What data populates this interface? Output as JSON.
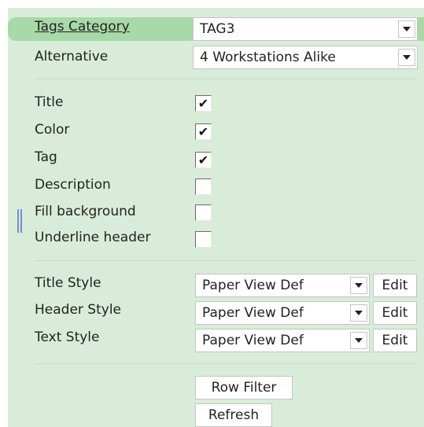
{
  "tags_category": {
    "label": "Tags Category",
    "value": "TAG3"
  },
  "alternative": {
    "label": "Alternative",
    "value": "4 Workstations Alike"
  },
  "options": [
    {
      "label": "Title",
      "checked": true
    },
    {
      "label": "Color",
      "checked": true
    },
    {
      "label": "Tag",
      "checked": true
    },
    {
      "label": "Description",
      "checked": false
    },
    {
      "label": "Fill background",
      "checked": false
    },
    {
      "label": "Underline header",
      "checked": false
    }
  ],
  "styles": [
    {
      "label": "Title Style",
      "value": "Paper View Def",
      "edit": "Edit"
    },
    {
      "label": "Header Style",
      "value": "Paper View Def",
      "edit": "Edit"
    },
    {
      "label": "Text Style",
      "value": "Paper View Def",
      "edit": "Edit"
    }
  ],
  "buttons": {
    "row_filter": "Row Filter",
    "refresh": "Refresh"
  },
  "check_glyph": "✔"
}
